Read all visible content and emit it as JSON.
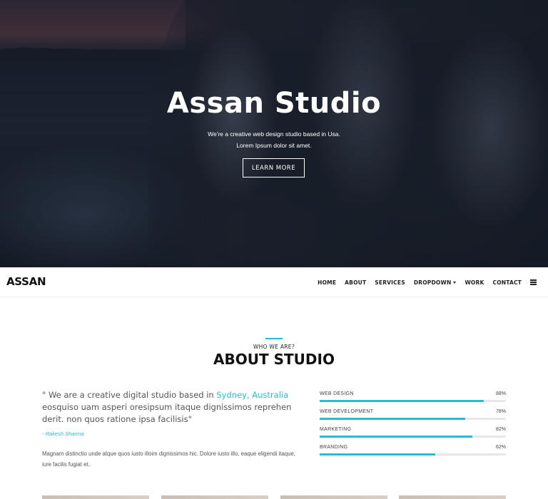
{
  "hero": {
    "title": "Assan Studio",
    "subtitle": "We're a creative web design studio based in Usa. Lorem Ipsum dolor sit amet.",
    "button_label": "LEARN MORE"
  },
  "navbar": {
    "logo": "ASSAN",
    "items": [
      {
        "label": "HOME"
      },
      {
        "label": "ABOUT"
      },
      {
        "label": "SERVICES"
      },
      {
        "label": "DROPDOWN"
      },
      {
        "label": "WORK"
      },
      {
        "label": "CONTACT"
      }
    ],
    "menu_icon": "list-icon"
  },
  "about": {
    "kicker": "WHO WE ARE?",
    "title": "ABOUT STUDIO",
    "quote_before": "\" We are a creative digital studio based in ",
    "quote_highlight": "Sydney, Australia",
    "quote_after": " eosquiso uam asperi oresipsum itaque dignissimos reprehen derit. non quos ratione ipsa facilisis\"",
    "quote_author": "- Rakesh Sharma",
    "body": "Magnam distinctio unde atque quos iusto illoim dignissimos hic. Dolore iusto illo, eaque eligendi itaque, iure facilis fugiat et.."
  },
  "skills": [
    {
      "label": "WEB DESIGN",
      "value": 88,
      "value_text": "88%"
    },
    {
      "label": "WEB DEVELOPMENT",
      "value": 78,
      "value_text": "78%"
    },
    {
      "label": "MARKETING",
      "value": 82,
      "value_text": "82%"
    },
    {
      "label": "BRANDING",
      "value": 62,
      "value_text": "62%"
    }
  ],
  "colors": {
    "accent": "#26bcd7",
    "text_dark": "#111111",
    "track": "#e8e8e8"
  }
}
